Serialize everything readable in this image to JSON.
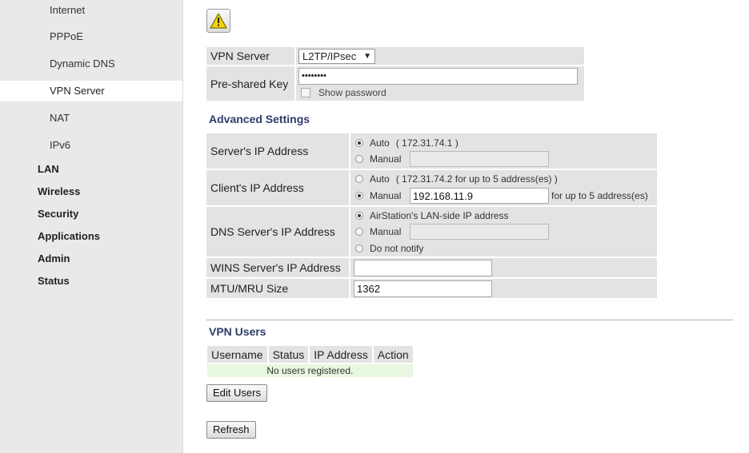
{
  "sidebar": {
    "sub_items": [
      {
        "label": "Internet",
        "active": false
      },
      {
        "label": "PPPoE",
        "active": false
      },
      {
        "label": "Dynamic DNS",
        "active": false
      },
      {
        "label": "VPN Server",
        "active": true
      },
      {
        "label": "NAT",
        "active": false
      },
      {
        "label": "IPv6",
        "active": false
      }
    ],
    "main_items": [
      "LAN",
      "Wireless",
      "Security",
      "Applications",
      "Admin",
      "Status"
    ]
  },
  "warning_icon": "warning-triangle-icon",
  "vpn_server": {
    "label": "VPN Server",
    "value": "L2TP/IPsec",
    "psk_label": "Pre-shared Key",
    "psk_value": "••••••••",
    "show_password": "Show password"
  },
  "advanced": {
    "title": "Advanced Settings",
    "server_ip": {
      "label": "Server's IP Address",
      "auto": "Auto",
      "auto_info": "( 172.31.74.1 )",
      "manual": "Manual",
      "manual_value": "",
      "selected": "auto"
    },
    "client_ip": {
      "label": "Client's IP Address",
      "auto": "Auto",
      "auto_info": "( 172.31.74.2 for up to 5 address(es) )",
      "manual": "Manual",
      "manual_value": "192.168.11.9",
      "manual_suffix": "for up to 5 address(es)",
      "selected": "manual"
    },
    "dns_ip": {
      "label": "DNS Server's IP Address",
      "opt1": "AirStation's LAN-side IP address",
      "opt2": "Manual",
      "opt3": "Do not notify",
      "manual_value": "",
      "selected": "opt1"
    },
    "wins_ip": {
      "label": "WINS Server's IP Address",
      "value": ""
    },
    "mtu": {
      "label": "MTU/MRU Size",
      "value": "1362"
    }
  },
  "vpn_users": {
    "title": "VPN Users",
    "columns": [
      "Username",
      "Status",
      "IP Address",
      "Action"
    ],
    "empty_message": "No users registered.",
    "edit_button": "Edit Users"
  },
  "refresh_button": "Refresh",
  "colors": {
    "section_title": "#2c3e6b",
    "empty_row": "#e7f7e0",
    "label_bg": "#e3e3e3"
  }
}
